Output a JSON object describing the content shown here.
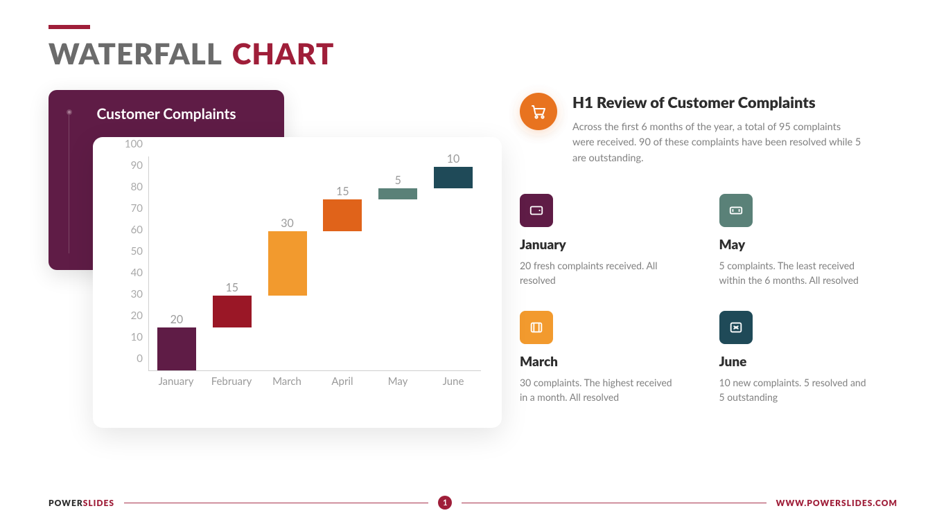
{
  "title": {
    "left": "WATERFALL",
    "right": "CHART"
  },
  "chartCard": {
    "title": "Customer Complaints"
  },
  "chart_data": {
    "type": "bar",
    "subtype": "waterfall",
    "title": "Customer Complaints",
    "ylabel": "",
    "xlabel": "",
    "ylim": [
      0,
      100
    ],
    "yticks": [
      0,
      10,
      20,
      30,
      40,
      50,
      60,
      70,
      80,
      90,
      100
    ],
    "categories": [
      "January",
      "February",
      "March",
      "April",
      "May",
      "June"
    ],
    "values": [
      20,
      15,
      30,
      15,
      5,
      10
    ],
    "cumulative_start": [
      0,
      20,
      35,
      65,
      80,
      85
    ],
    "cumulative_end": [
      20,
      35,
      65,
      80,
      85,
      95
    ],
    "colors": [
      "#5f1c46",
      "#9a1726",
      "#f29a2e",
      "#e0631a",
      "#5a8178",
      "#1f4a58"
    ]
  },
  "review": {
    "title": "H1 Review of Customer Complaints",
    "body": "Across the first 6 months of the year, a total of 95 complaints were received. 90 of these complaints have been resolved while 5 are outstanding."
  },
  "items": [
    {
      "title": "January",
      "desc": "20 fresh complaints received. All resolved",
      "class": "ic-purple"
    },
    {
      "title": "May",
      "desc": "5 complaints. The least received within the 6 months. All resolved",
      "class": "ic-green"
    },
    {
      "title": "March",
      "desc": "30 complaints. The highest received in a month. All resolved",
      "class": "ic-orange"
    },
    {
      "title": "June",
      "desc": "10 new complaints. 5 resolved and 5 outstanding",
      "class": "ic-teal"
    }
  ],
  "footer": {
    "brandA": "POWER",
    "brandB": "SLIDES",
    "page": "1",
    "url": "WWW.POWERSLIDES.COM"
  }
}
